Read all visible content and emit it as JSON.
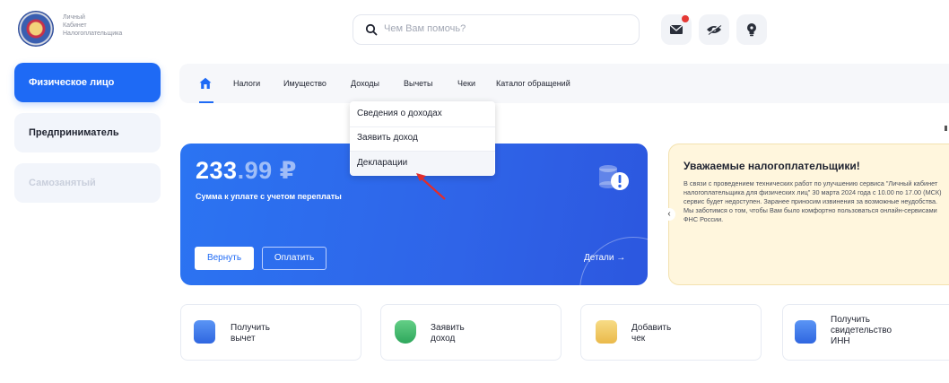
{
  "header": {
    "logo_text": "Личный\nКабинет\nНалогоплательщика",
    "search_placeholder": "Чем Вам помочь?"
  },
  "sidebar": {
    "items": [
      {
        "label": "Физическое лицо",
        "state": "active"
      },
      {
        "label": "Предприниматель",
        "state": "normal"
      },
      {
        "label": "Самозанятый",
        "state": "disabled"
      }
    ]
  },
  "nav": {
    "items": [
      "Налоги",
      "Имущество",
      "Доходы",
      "Вычеты",
      "Чеки",
      "Каталог обращений"
    ]
  },
  "dropdown": {
    "items": [
      "Сведения о доходах",
      "Заявить доход",
      "Декларации"
    ]
  },
  "balance": {
    "amount_main": "233",
    "amount_fraction": ".99",
    "currency": "₽",
    "subtitle": "Сумма к уплате с учетом переплаты",
    "return_label": "Вернуть",
    "pay_label": "Оплатить",
    "details_label": "Детали",
    "details_arrow": "→"
  },
  "notice": {
    "title": "Уважаемые налогоплательщики!",
    "body": "В связи с проведением технических работ по улучшению сервиса \"Личный кабинет налогоплательщика для физических лиц\" 30 марта 2024 года с 10.00 по 17.00 (МСК) сервис будет недоступен. Заранее приносим извинения за возможные неудобства. Мы заботимся о том, чтобы Вам было комфортно пользоваться онлайн-сервисами ФНС России."
  },
  "actions": [
    {
      "line1": "Получить",
      "line2": "вычет",
      "line3": "",
      "icon": "wallet-icon",
      "color": "#3a7bef"
    },
    {
      "line1": "Заявить",
      "line2": "доход",
      "line3": "",
      "icon": "income-icon",
      "color": "#3db86a"
    },
    {
      "line1": "Добавить",
      "line2": "чек",
      "line3": "",
      "icon": "receipt-icon",
      "color": "#f1c45a"
    },
    {
      "line1": "Получить",
      "line2": "свидетельство",
      "line3": "ИНН",
      "icon": "certificate-icon",
      "color": "#3a7bef"
    }
  ],
  "colors": {
    "accent": "#1e6af5",
    "notice_bg": "#fff6dd",
    "notification_dot": "#e53935"
  }
}
